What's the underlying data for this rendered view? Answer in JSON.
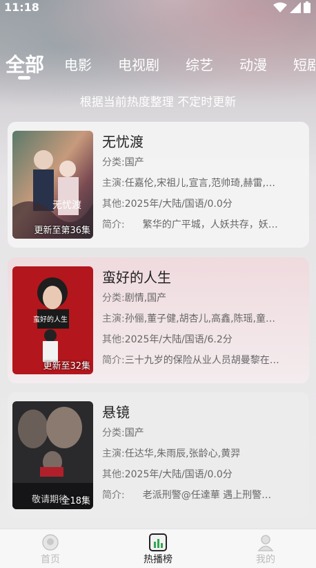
{
  "status_bar": {
    "time": "11:18"
  },
  "tabs": [
    {
      "label": "全部",
      "active": true
    },
    {
      "label": "电影",
      "active": false
    },
    {
      "label": "电视剧",
      "active": false
    },
    {
      "label": "综艺",
      "active": false
    },
    {
      "label": "动漫",
      "active": false
    },
    {
      "label": "短剧",
      "active": false
    }
  ],
  "subtitle": "根据当前热度整理 不定时更新",
  "labels": {
    "genre": "分类:",
    "cast": "主演:",
    "other": "其他:",
    "intro": "简介:"
  },
  "items": [
    {
      "title": "无忧渡",
      "episode": "更新至第36集",
      "genre": "国产",
      "cast": "任嘉伦,宋祖儿,宣言,范帅琦,赫雷,…",
      "other": "2025年/大陆/国语/0.0分",
      "intro": "繁华的广平城，人妖共存，妖…",
      "poster_text": "无忧渡"
    },
    {
      "title": "蛮好的人生",
      "episode": "更新至32集",
      "genre": "剧情,国产",
      "cast": "孙俪,董子健,胡杏儿,高鑫,陈瑶,童…",
      "other": "2025年/大陆/国语/6.2分",
      "intro": "三十九岁的保险从业人员胡曼黎在…",
      "poster_text": "蛮好的人生"
    },
    {
      "title": "悬镜",
      "episode": "全18集",
      "genre": "国产",
      "cast": "任达华,朱雨辰,张龄心,黄羿",
      "other": "2025年/大陆/国语/0.0分",
      "intro": "老派刑警@任達華 遇上刑警…",
      "poster_text": "敬请期待"
    }
  ],
  "bottom_nav": [
    {
      "label": "首页",
      "icon": "home-icon",
      "active": false
    },
    {
      "label": "热播榜",
      "icon": "chart-icon",
      "active": true
    },
    {
      "label": "我的",
      "icon": "profile-icon",
      "active": false
    }
  ]
}
